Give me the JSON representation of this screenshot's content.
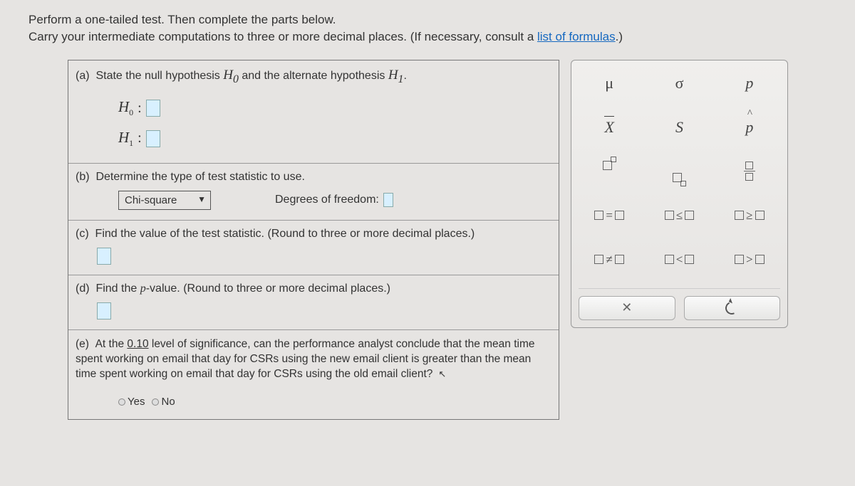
{
  "instructions": {
    "line1": "Perform a one-tailed test. Then complete the parts below.",
    "line2_pre": "Carry your intermediate computations to three or more decimal places. (If necessary, consult a ",
    "link": "list of formulas",
    "line2_post": ".)"
  },
  "parts": {
    "a": {
      "label": "(a)",
      "text_pre": "State the null hypothesis ",
      "h0": "H",
      "h0_sub": "0",
      "text_mid": " and the alternate hypothesis ",
      "h1": "H",
      "h1_sub": "1",
      "text_post": "."
    },
    "b": {
      "label": "(b)",
      "text": "Determine the type of test statistic to use.",
      "select_value": "Chi-square",
      "freedom_label": "Degrees of freedom:"
    },
    "c": {
      "label": "(c)",
      "text": "Find the value of the test statistic. (Round to three or more decimal places.)"
    },
    "d": {
      "label": "(d)",
      "text_pre": "Find the ",
      "pval": "p",
      "text_post": "-value. (Round to three or more decimal places.)"
    },
    "e": {
      "label": "(e)",
      "text_pre": "At the ",
      "level": "0.10",
      "text_post": " level of significance, can the performance analyst conclude that the mean time spent working on email that day for CSRs using the new email client is greater than the mean time spent working on email that day for CSRs using the old email client?",
      "yes": "Yes",
      "no": "No"
    }
  },
  "palette": {
    "mu": "μ",
    "sigma": "σ",
    "p": "p",
    "x": "X",
    "s": "S",
    "eq": "=",
    "le": "≤",
    "ge": "≥",
    "ne": "≠",
    "lt": "<",
    "gt": ">",
    "close": "✕"
  }
}
